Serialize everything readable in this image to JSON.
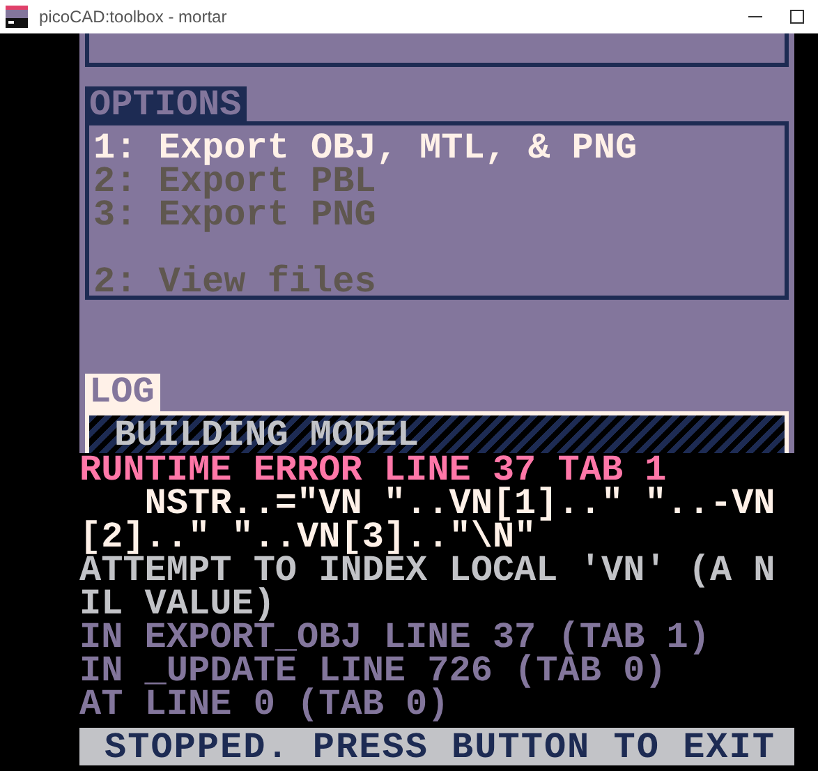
{
  "window": {
    "title": "picoCAD:toolbox - mortar"
  },
  "options": {
    "title": "OPTIONS",
    "items": [
      {
        "label": "1: Export OBJ, MTL, & PNG",
        "disabled": false
      },
      {
        "label": "2: Export PBL",
        "disabled": true
      },
      {
        "label": "3: Export PNG",
        "disabled": true
      }
    ],
    "footer_items": [
      {
        "label": "2: View files",
        "disabled": true
      }
    ]
  },
  "log": {
    "title": "LOG",
    "entry": "BUILDING MODEL"
  },
  "error_lines": [
    {
      "text": "RUNTIME ERROR LINE 37 TAB 1",
      "kind": "error"
    },
    {
      "text": "   NSTR..=\"VN \"..VN[1]..\" \"..-VN",
      "kind": "code"
    },
    {
      "text": "[2]..\" \"..VN[3]..\"\\N\"",
      "kind": "code"
    },
    {
      "text": "ATTEMPT TO INDEX LOCAL 'VN' (A N",
      "kind": "message"
    },
    {
      "text": "IL VALUE)",
      "kind": "message"
    },
    {
      "text": "IN EXPORT_OBJ LINE 37 (TAB 1)",
      "kind": "trace"
    },
    {
      "text": "IN _UPDATE LINE 726 (TAB 0)",
      "kind": "trace"
    },
    {
      "text": "AT LINE 0 (TAB 0)",
      "kind": "trace"
    }
  ],
  "status_bar": "STOPPED. PRESS BUTTON TO EXIT"
}
